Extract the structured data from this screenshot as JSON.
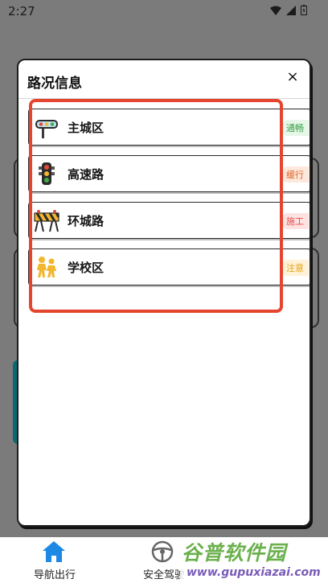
{
  "status_bar": {
    "time": "2:27"
  },
  "dialog": {
    "title": "路况信息",
    "close_glyph": "×",
    "items": [
      {
        "label": "主城区",
        "status": "通畅",
        "icon": "traffic-light-icon",
        "status_color": "#3aa24a"
      },
      {
        "label": "高速路",
        "status": "缓行",
        "icon": "traffic-light-vertical-icon",
        "status_color": "#e0662a"
      },
      {
        "label": "环城路",
        "status": "施工",
        "icon": "construction-barrier-icon",
        "status_color": "#e64a4a"
      },
      {
        "label": "学校区",
        "status": "注意",
        "icon": "children-crossing-icon",
        "status_color": "#e6a213"
      }
    ]
  },
  "bottom_nav": {
    "items": [
      {
        "label": "导航出行",
        "icon": "home-icon"
      },
      {
        "label": "安全驾驶",
        "icon": "steering-wheel-icon"
      }
    ]
  },
  "watermark": {
    "main": "谷普软件园",
    "url": "www.gupuxiazai.com"
  },
  "colors": {
    "highlight": "#e5442e",
    "teal": "#0a6a73"
  }
}
